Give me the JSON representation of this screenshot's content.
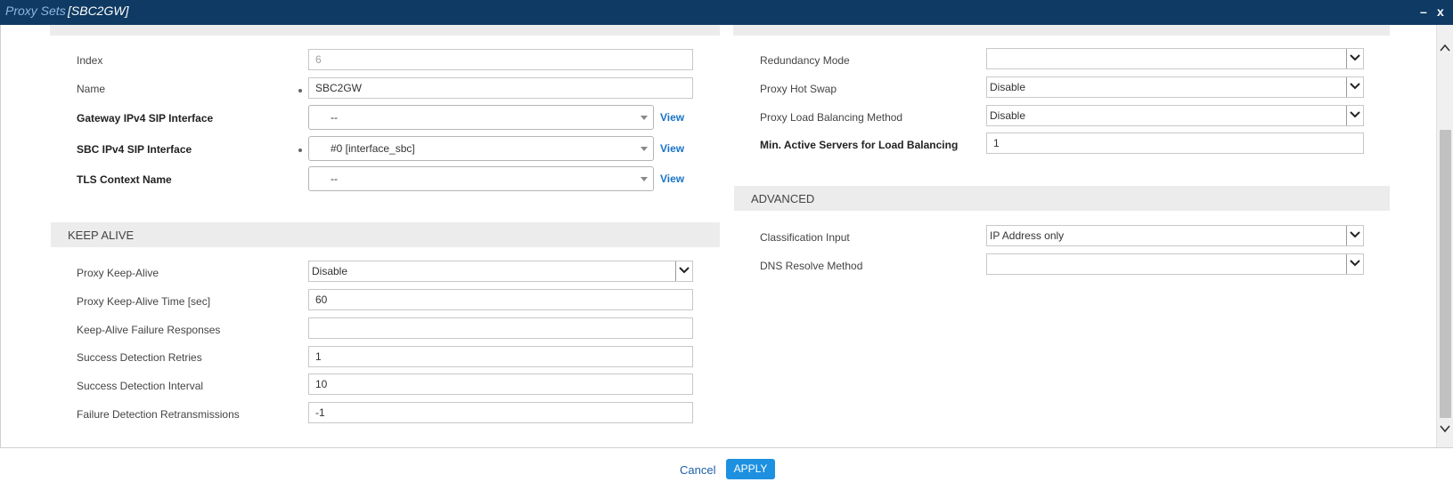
{
  "window": {
    "title": "Proxy Sets",
    "subtitle": "[SBC2GW]",
    "minimize_label": "–",
    "close_label": "x"
  },
  "left": {
    "index": {
      "label": "Index",
      "value": "6"
    },
    "name": {
      "label": "Name",
      "value": "SBC2GW"
    },
    "gateway_if": {
      "label": "Gateway IPv4 SIP Interface",
      "value": "--",
      "link": "View"
    },
    "sbc_if": {
      "label": "SBC IPv4 SIP Interface",
      "value": "#0 [interface_sbc]",
      "link": "View"
    },
    "tls": {
      "label": "TLS Context Name",
      "value": "--",
      "link": "View"
    }
  },
  "keep_alive": {
    "header": "KEEP ALIVE",
    "proxy_keep_alive": {
      "label": "Proxy Keep-Alive",
      "value": "Disable"
    },
    "keep_alive_time": {
      "label": "Proxy Keep-Alive Time [sec]",
      "value": "60"
    },
    "failure_responses": {
      "label": "Keep-Alive Failure Responses",
      "value": ""
    },
    "success_retries": {
      "label": "Success Detection Retries",
      "value": "1"
    },
    "success_interval": {
      "label": "Success Detection Interval",
      "value": "10"
    },
    "failure_retrans": {
      "label": "Failure Detection Retransmissions",
      "value": "-1"
    }
  },
  "right": {
    "redundancy": {
      "label": "Redundancy Mode",
      "value": ""
    },
    "hot_swap": {
      "label": "Proxy Hot Swap",
      "value": "Disable"
    },
    "load_balancing": {
      "label": "Proxy Load Balancing Method",
      "value": "Disable"
    },
    "min_active": {
      "label": "Min. Active Servers for Load Balancing",
      "value": "1"
    }
  },
  "advanced": {
    "header": "ADVANCED",
    "classification": {
      "label": "Classification Input",
      "value": "IP Address only"
    },
    "dns_resolve": {
      "label": "DNS Resolve Method",
      "value": ""
    }
  },
  "footer": {
    "cancel_label": "Cancel",
    "apply_label": "APPLY"
  },
  "colors": {
    "titlebar": "#0f3a63",
    "accent": "#1e90e0",
    "link": "#1a73c8"
  }
}
